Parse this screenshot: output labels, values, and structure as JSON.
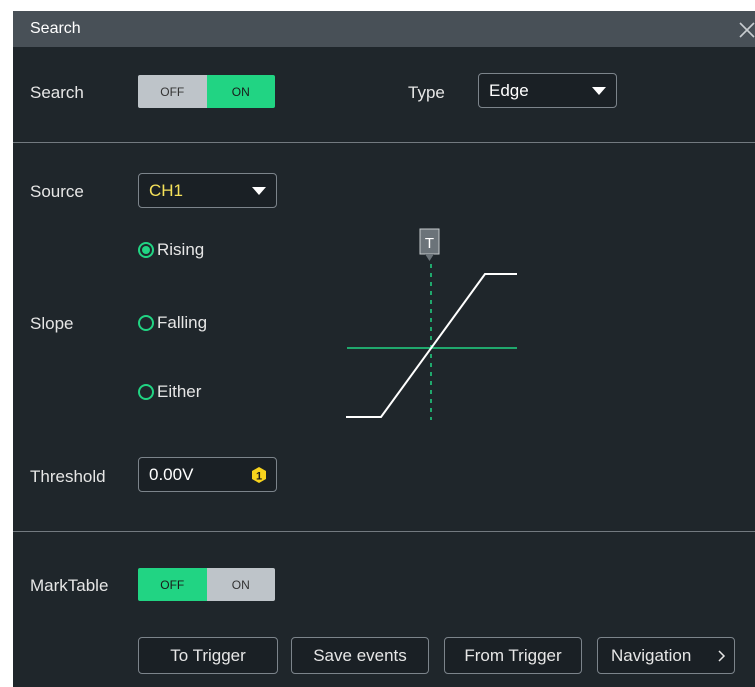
{
  "dialog": {
    "title": "Search"
  },
  "search": {
    "label": "Search",
    "off": "OFF",
    "on": "ON",
    "state": "on"
  },
  "type": {
    "label": "Type",
    "value": "Edge"
  },
  "source": {
    "label": "Source",
    "value": "CH1"
  },
  "slope": {
    "label": "Slope",
    "options": [
      "Rising",
      "Falling",
      "Either"
    ],
    "selected": "Rising",
    "trigger_marker": "T"
  },
  "threshold": {
    "label": "Threshold",
    "value": "0.00V",
    "badge": "1"
  },
  "marktable": {
    "label": "MarkTable",
    "off": "OFF",
    "on": "ON",
    "state": "off"
  },
  "buttons": [
    "To Trigger",
    "Save events",
    "From Trigger",
    "Navigation"
  ],
  "icons": {
    "close": "close-icon",
    "dropdown": "caret-down-icon",
    "knob": "knob-1-icon",
    "next": "chevron-right-icon"
  },
  "colors": {
    "accent": "#21d483",
    "source": "#f5e15a",
    "badge": "#f7d31d"
  }
}
